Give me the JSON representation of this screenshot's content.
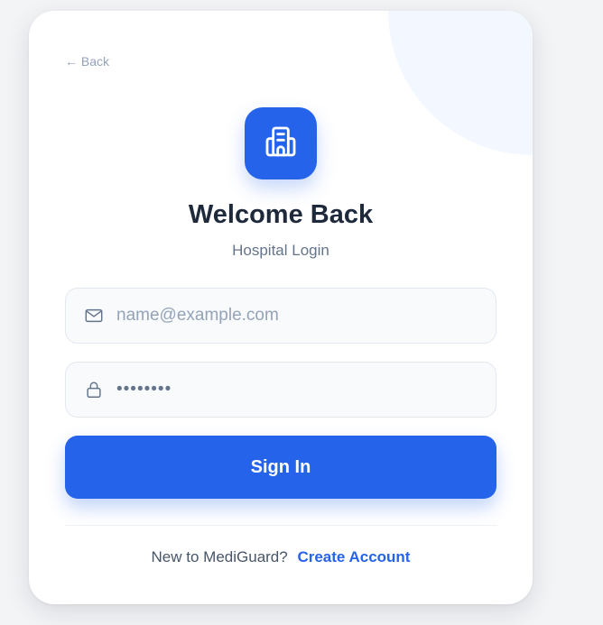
{
  "back_link": "← Back",
  "logo": {
    "icon": "hospital-building-icon"
  },
  "title": "Welcome Back",
  "subtitle": "Hospital Login",
  "email_field": {
    "icon": "mail-icon",
    "placeholder": "name@example.com",
    "value": ""
  },
  "password_field": {
    "icon": "lock-icon",
    "placeholder": "••••••••",
    "value": ""
  },
  "signin_label": "Sign In",
  "footer": {
    "prompt": "New to MediGuard?",
    "link_label": "Create Account"
  },
  "colors": {
    "primary": "#2563eb",
    "heading": "#1e293b",
    "muted": "#64748b",
    "background": "#f3f4f6",
    "card": "#ffffff"
  }
}
